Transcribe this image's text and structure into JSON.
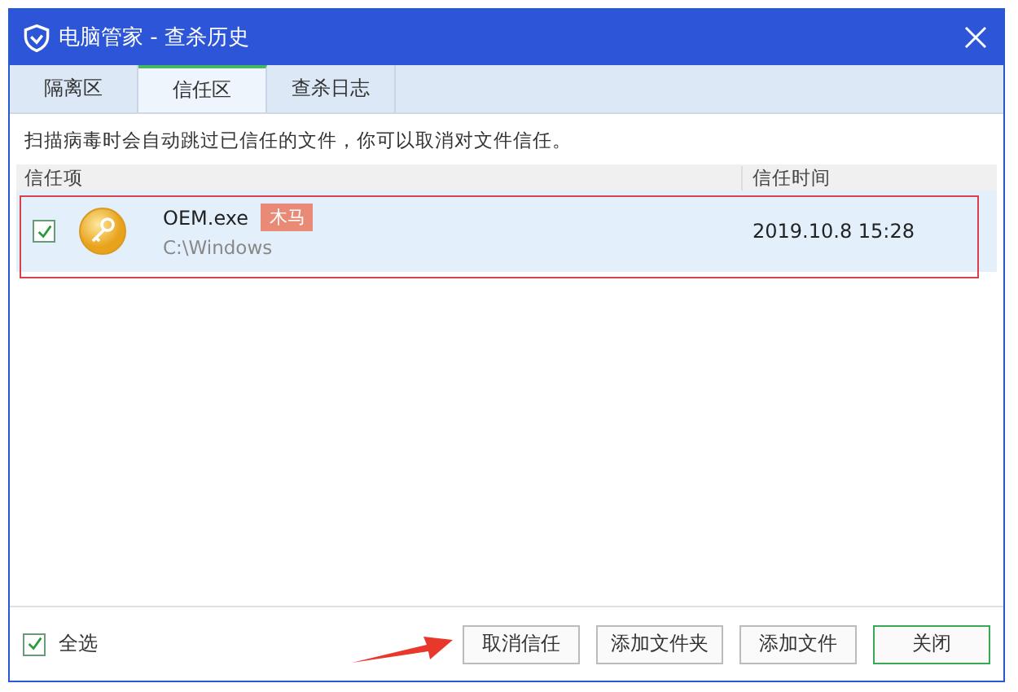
{
  "window": {
    "title": "电脑管家 - 查杀历史"
  },
  "tabs": [
    {
      "label": "隔离区",
      "selected": false
    },
    {
      "label": "信任区",
      "selected": true
    },
    {
      "label": "查杀日志",
      "selected": false
    }
  ],
  "notice": "扫描病毒时会自动跳过已信任的文件，你可以取消对文件信任。",
  "table": {
    "columns": [
      "信任项",
      "信任时间"
    ],
    "rows": [
      {
        "checked": true,
        "selected": true,
        "name": "OEM.exe",
        "tag": "木马",
        "path": "C:\\Windows",
        "time": "2019.10.8 15:28"
      }
    ]
  },
  "select_all": {
    "label": "全选",
    "checked": true
  },
  "buttons": [
    {
      "label": "取消信任",
      "kind": "normal"
    },
    {
      "label": "添加文件夹",
      "kind": "normal"
    },
    {
      "label": "添加文件",
      "kind": "normal"
    },
    {
      "label": "关闭",
      "kind": "primary"
    }
  ]
}
